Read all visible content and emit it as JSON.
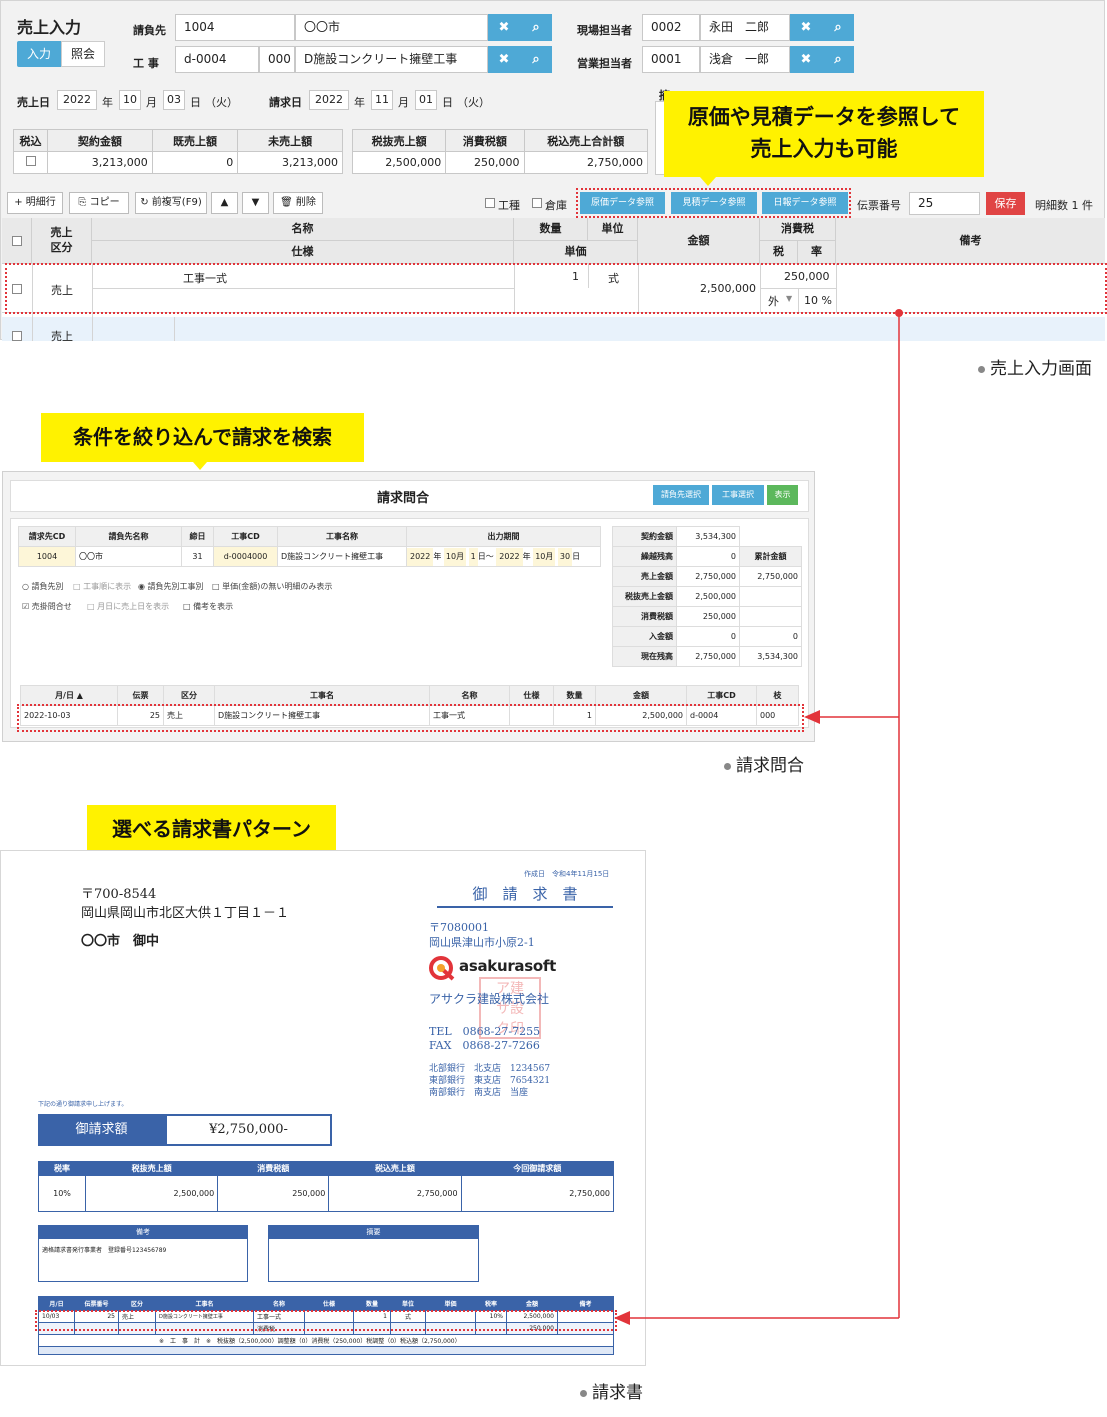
{
  "sales": {
    "title": "売上入力",
    "mode_input": "入力",
    "mode_ref": "照会",
    "billing_label": "請負先",
    "billing_code": "1004",
    "billing_name": "〇〇市",
    "work_label": "工 事",
    "work_code": "d-0004",
    "work_sub": "000",
    "work_name": "D施設コンクリート擁壁工事",
    "site_label": "現場担当者",
    "site_code": "0002",
    "site_name": "永田　二郎",
    "sales_staff_label": "営業担当者",
    "sales_staff_code": "0001",
    "sales_staff_name": "浅倉　一郎",
    "date_label": "売上日",
    "date_y": "2022",
    "date_m": "10",
    "date_d": "03",
    "date_wd": "（火）",
    "bill_date_label": "請求日",
    "bill_y": "2022",
    "bill_m": "11",
    "bill_d": "01",
    "bill_wd": "（火）",
    "y_unit": "年",
    "m_unit": "月",
    "d_unit": "日",
    "summary_label": "摘",
    "sum_headers": [
      "税込",
      "契約金額",
      "既売上額",
      "未売上額"
    ],
    "sum_values": [
      "3,213,000",
      "0",
      "3,213,000"
    ],
    "tax_headers": [
      "税抜売上額",
      "消費税額",
      "税込売上合計額"
    ],
    "tax_values": [
      "2,500,000",
      "250,000",
      "2,750,000"
    ],
    "toolbar": {
      "add": "+ 明細行",
      "copy": "⎘ コピー",
      "prev": "↻ 前複写(F9)",
      "up": "▲",
      "down": "▼",
      "delete": "🗑 削除"
    },
    "chk_kind": "工種",
    "chk_store": "倉庫",
    "ref_cost": "原価データ参照",
    "ref_est": "見積データ参照",
    "ref_daily": "日報データ参照",
    "slip_label": "伝票番号",
    "slip_no": "25",
    "save": "保存",
    "line_count": "明細数 1 件",
    "grid_h": {
      "kbn1": "売上",
      "kbn2": "区分",
      "name": "名称",
      "spec": "仕様",
      "qty": "数量",
      "unit": "単位",
      "price": "単価",
      "amount": "金額",
      "tax": "消費税",
      "tax1": "税",
      "tax2": "率",
      "note": "備考"
    },
    "row1": {
      "kbn": "売上",
      "name": "工事一式",
      "qty": "1",
      "unit": "式",
      "amount": "2,500,000",
      "tax": "250,000",
      "tax_kind": "外",
      "rate": "10 %"
    },
    "row2": {
      "kbn": "売上"
    },
    "callout": "原価や見積データを参照して\n売上入力も可能",
    "caption": "売上入力画面"
  },
  "inquiry": {
    "callout": "条件を絞り込んで請求を検索",
    "title": "請求問合",
    "btn_sel_bill": "請負先選択",
    "btn_sel_work": "工事選択",
    "btn_show": "表示",
    "h": [
      "請求先CD",
      "請負先名称",
      "締日",
      "工事CD",
      "工事名称",
      "出力期間"
    ],
    "v": {
      "cd": "1004",
      "name": "〇〇市",
      "close": "31",
      "wcd": "d-0004000",
      "wname": "D施設コンクリート擁壁工事",
      "from_y": "2022",
      "from_m": "10月",
      "from_d": "1",
      "to_y": "2022",
      "to_m": "10月",
      "to_d": "30"
    },
    "year": "年",
    "day": "日",
    "tilde": "日〜",
    "opt1": "○ 請負先別",
    "opt2": "□ 工事順に表示",
    "opt3": "◉ 請負先別工事別",
    "opt4": "□ 単価(金額)の無い明細のみ表示",
    "opt5": "☑ 売掛問合せ",
    "opt6": "□ 月日に売上日を表示",
    "opt7": "□ 備考を表示",
    "right_labels": [
      "契約金額",
      "繰越残高",
      "売上金額",
      "税抜売上金額",
      "消費税額",
      "入金額",
      "現在残高"
    ],
    "right_vals": [
      "3,534,300",
      "0",
      "2,750,000",
      "2,500,000",
      "250,000",
      "0",
      "2,750,000"
    ],
    "right_h2": "累計金額",
    "right_vals2": [
      "",
      "",
      "2,750,000",
      "",
      "",
      "0",
      "3,534,300"
    ],
    "list_h": [
      "月/日 ▲",
      "伝票",
      "区分",
      "工事名",
      "名称",
      "仕様",
      "数量",
      "金額",
      "工事CD",
      "枝"
    ],
    "list_v": [
      "2022-10-03",
      "25",
      "売上",
      "D施設コンクリート擁壁工事",
      "工事一式",
      "",
      "1",
      "2,500,000",
      "d-0004",
      "000"
    ],
    "caption": "請求問合"
  },
  "invoice": {
    "callout": "選べる請求書パターン",
    "zip": "〒700-8544",
    "addr": "岡山県岡山市北区大供１丁目１－１",
    "to": "〇〇市　御中",
    "date": "作成日　令和4年11月15日",
    "title": "御　請　求　書",
    "co_zip": "〒7080001",
    "co_addr": "岡山県津山市小原2-1",
    "brand": "asakurasoft",
    "co_name": "アサクラ建設株式会社",
    "tel": "TEL　0868-27-7255",
    "fax": "FAX　0868-27-7266",
    "bank1": "北部銀行　北支店　1234567",
    "bank2": "東部銀行　東支店　7654321",
    "bank3": "南部銀行　南支店　当座",
    "lead": "下記の通り御請求申し上げます。",
    "amt_label": "御請求額",
    "amt": "¥2,750,000-",
    "t1_h": [
      "税率",
      "税抜売上額",
      "消費税額",
      "税込売上額",
      "今回御請求額"
    ],
    "t1_v": [
      "10%",
      "2,500,000",
      "250,000",
      "2,750,000",
      "2,750,000"
    ],
    "note_h": "備考",
    "note_v": "適格請求書発行事業者　登録番号123456789",
    "memo_h": "摘要",
    "t2_h": [
      "月/日",
      "伝票番号",
      "区分",
      "工事名",
      "名称",
      "仕様",
      "数量",
      "単位",
      "単価",
      "税率",
      "金額",
      "備考"
    ],
    "t2_v": [
      "10/03",
      "25",
      "売上",
      "D施設コンクリート擁壁工事",
      "工事一式",
      "",
      "1",
      "式",
      "",
      "10%",
      "2,500,000",
      ""
    ],
    "t2_tax_label": "消費税",
    "t2_tax": "250,000",
    "t2_total": "※　工　事　計　※　税抜額（2,500,000）調整額（0）消費税（250,000）税調整（0）税込額（2,750,000）",
    "caption": "請求書"
  }
}
